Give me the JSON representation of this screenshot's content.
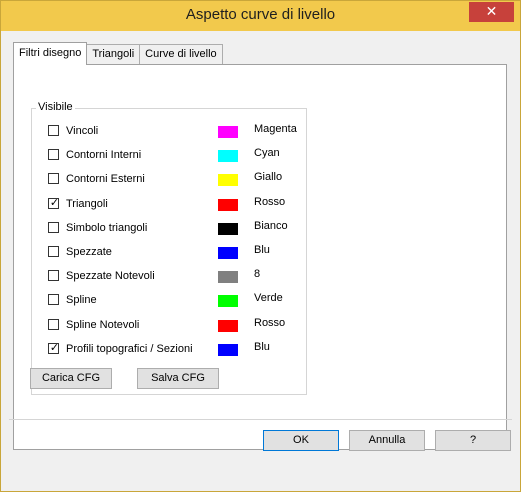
{
  "window": {
    "title": "Aspetto curve di livello",
    "close_glyph": "✕"
  },
  "tabs": [
    {
      "label": "Filtri disegno",
      "active": true
    },
    {
      "label": "Triangoli",
      "active": false
    },
    {
      "label": "Curve di livello",
      "active": false
    }
  ],
  "group": {
    "label": "Visibile",
    "items": [
      {
        "label": "Vincoli",
        "checked": false,
        "color": "#ff00ff",
        "color_name": "Magenta"
      },
      {
        "label": "Contorni Interni",
        "checked": false,
        "color": "#00ffff",
        "color_name": "Cyan"
      },
      {
        "label": "Contorni Esterni",
        "checked": false,
        "color": "#ffff00",
        "color_name": "Giallo"
      },
      {
        "label": "Triangoli",
        "checked": true,
        "color": "#ff0000",
        "color_name": "Rosso"
      },
      {
        "label": "Simbolo triangoli",
        "checked": false,
        "color": "#000000",
        "color_name": "Bianco"
      },
      {
        "label": "Spezzate",
        "checked": false,
        "color": "#0000ff",
        "color_name": "Blu"
      },
      {
        "label": "Spezzate Notevoli",
        "checked": false,
        "color": "#808080",
        "color_name": "8"
      },
      {
        "label": "Spline",
        "checked": false,
        "color": "#00ff00",
        "color_name": "Verde"
      },
      {
        "label": "Spline Notevoli",
        "checked": false,
        "color": "#ff0000",
        "color_name": "Rosso"
      },
      {
        "label": "Profili topografici / Sezioni",
        "checked": true,
        "color": "#0000ff",
        "color_name": "Blu"
      }
    ]
  },
  "config_buttons": {
    "load": "Carica CFG",
    "save": "Salva CFG"
  },
  "footer": {
    "ok": "OK",
    "cancel": "Annulla",
    "help": "?"
  }
}
